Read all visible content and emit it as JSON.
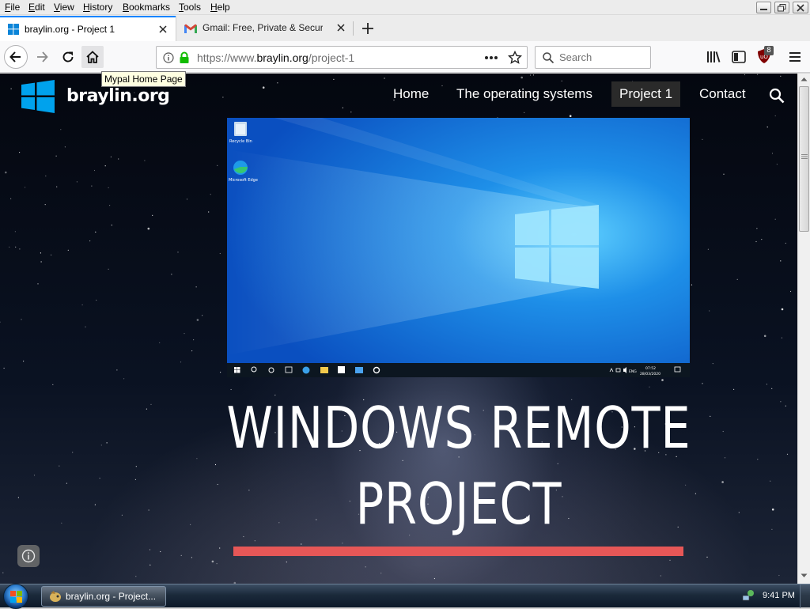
{
  "menubar": {
    "items": [
      {
        "accel": "F",
        "rest": "ile"
      },
      {
        "accel": "E",
        "rest": "dit"
      },
      {
        "accel": "V",
        "rest": "iew"
      },
      {
        "accel": "H",
        "rest": "istory"
      },
      {
        "accel": "B",
        "rest": "ookmarks"
      },
      {
        "accel": "T",
        "rest": "ools"
      },
      {
        "accel": "H",
        "rest": "elp"
      }
    ]
  },
  "tabs": [
    {
      "title": "braylin.org - Project 1",
      "active": true,
      "icon": "windows-icon"
    },
    {
      "title": "Gmail: Free, Private & Secure E",
      "active": false,
      "icon": "gmail-icon"
    }
  ],
  "navbar": {
    "url_prefix": "https://www.",
    "url_host": "braylin.org",
    "url_path": "/project-1",
    "search_placeholder": "Search",
    "ublock_badge": "8"
  },
  "tooltip": {
    "text": "Mypal Home Page"
  },
  "site": {
    "name": "braylin.org",
    "nav": [
      "Home",
      "The operating systems",
      "Project 1",
      "Contact"
    ],
    "current_nav": "Project 1",
    "hero_title_line1": "WINDOWS REMOTE",
    "hero_title_line2": "PROJECT",
    "accent_color": "#e65757"
  },
  "screenshot": {
    "desktop_icons": [
      "Recycle Bin",
      "Microsoft Edge"
    ],
    "tray_lang": "ENG",
    "tray_time": "07:52",
    "tray_date": "28/03/2020"
  },
  "taskbar": {
    "task_label": "braylin.org - Project...",
    "clock": "9:41 PM"
  }
}
